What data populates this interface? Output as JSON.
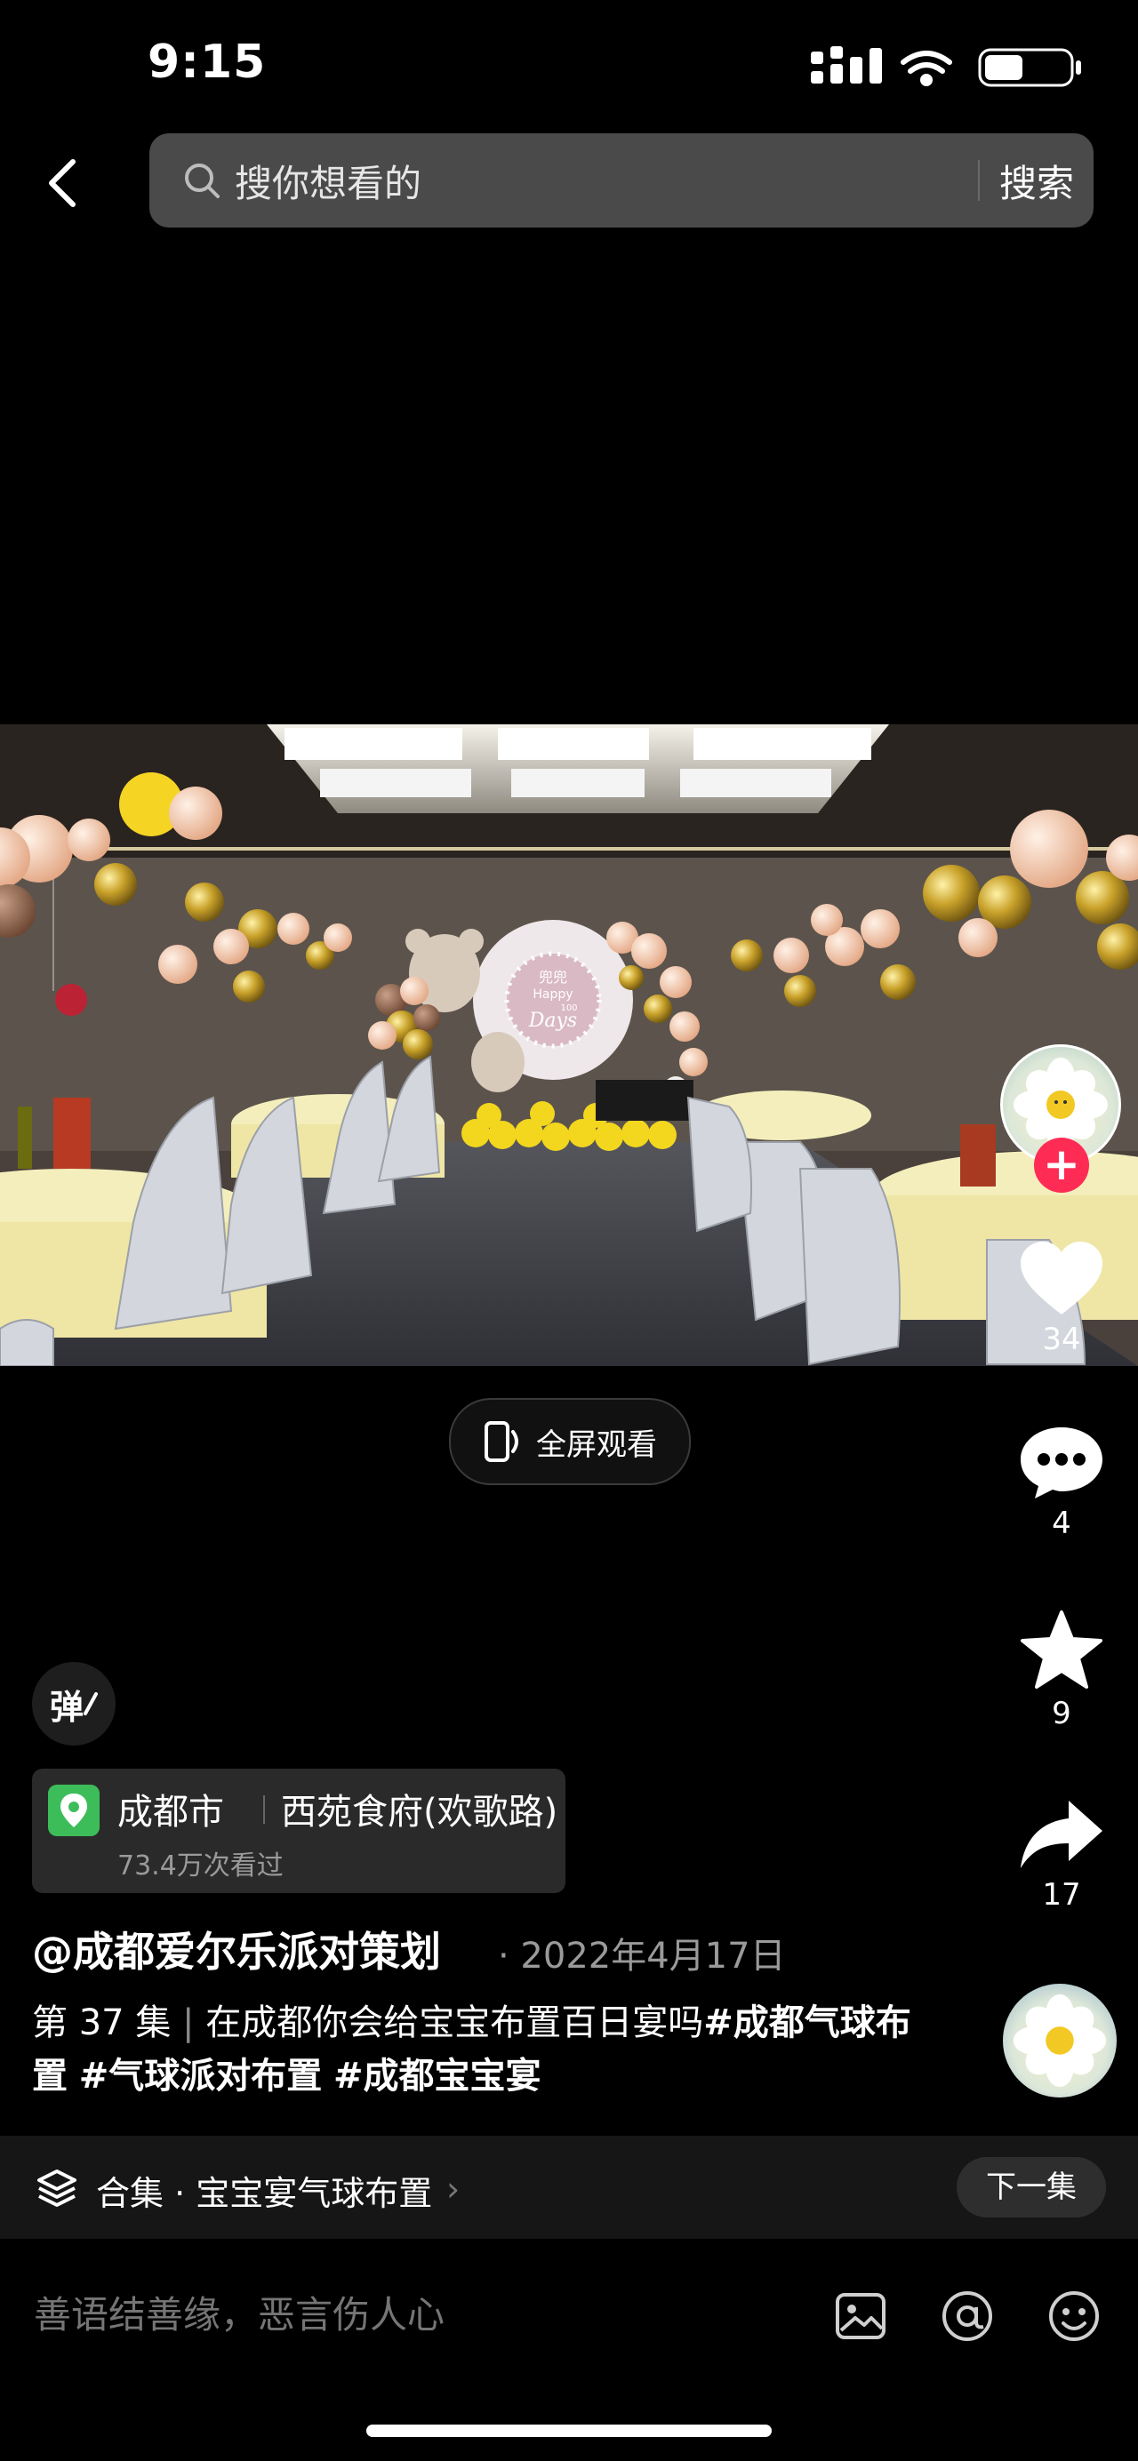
{
  "status_bar": {
    "time": "9:15",
    "battery_level": 0.45
  },
  "search": {
    "placeholder": "搜你想看的",
    "submit_label": "搜索"
  },
  "video": {
    "banner_top": "兜兜",
    "banner_main": "Happy",
    "banner_sub": "100",
    "banner_days": "Days"
  },
  "actions": {
    "likes": "34",
    "comments": "4",
    "favorites": "9",
    "shares": "17"
  },
  "fullscreen_label": "全屏观看",
  "danmaku_label": "弹",
  "location": {
    "city": "成都市",
    "place": "西苑食府(欢歌路)",
    "views": "73.4万次看过"
  },
  "author": "@成都爱尔乐派对策划",
  "date": "· 2022年4月17日",
  "description": {
    "episode": "第 37 集",
    "text": "在成都你会给宝宝布置百日宴吗",
    "tag_1": "#成都气球布置",
    "tag_2": "#气球派对布置",
    "tag_3": "#成都宝宝宴"
  },
  "collection": {
    "label": "合集 · 宝宝宴气球布置",
    "next_label": "下一集"
  },
  "comment_bar": {
    "placeholder": "善语结善缘，恶言伤人心"
  },
  "colors": {
    "accent": "#fe2c55",
    "location_pin": "#3dbd5a"
  },
  "icons": [
    "back-icon",
    "search-icon",
    "heart-icon",
    "comment-icon",
    "star-icon",
    "share-icon",
    "fullscreen-icon",
    "collection-icon",
    "image-icon",
    "at-icon",
    "emoji-icon"
  ]
}
